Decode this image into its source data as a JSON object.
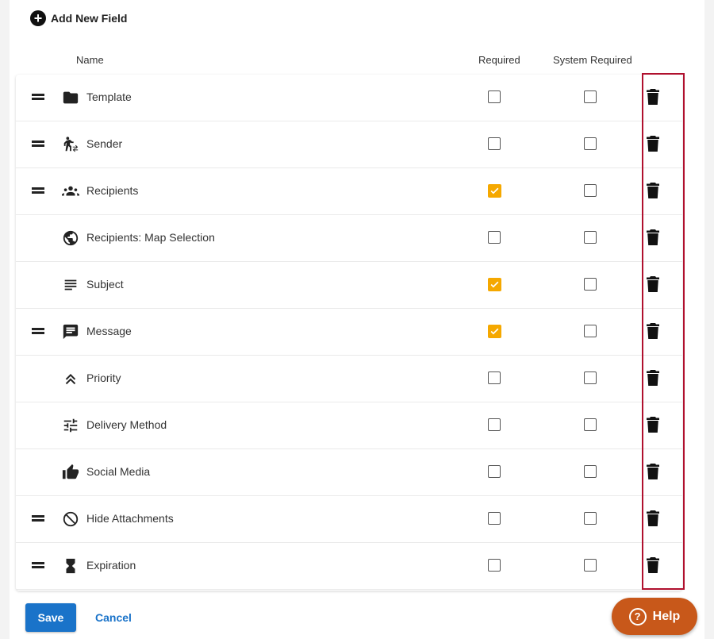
{
  "toolbar": {
    "add_field_label": "Add New Field"
  },
  "columns": {
    "name": "Name",
    "required": "Required",
    "system_required": "System Required"
  },
  "fields": [
    {
      "label": "Template",
      "icon": "folder-icon",
      "draggable": true,
      "required": false,
      "system_required": false
    },
    {
      "label": "Sender",
      "icon": "sender-icon",
      "draggable": true,
      "required": false,
      "system_required": false
    },
    {
      "label": "Recipients",
      "icon": "people-icon",
      "draggable": true,
      "required": true,
      "system_required": false
    },
    {
      "label": "Recipients: Map Selection",
      "icon": "globe-icon",
      "draggable": false,
      "required": false,
      "system_required": false
    },
    {
      "label": "Subject",
      "icon": "subject-lines-icon",
      "draggable": false,
      "required": true,
      "system_required": false
    },
    {
      "label": "Message",
      "icon": "message-icon",
      "draggable": true,
      "required": true,
      "system_required": false
    },
    {
      "label": "Priority",
      "icon": "double-chevron-up-icon",
      "draggable": false,
      "required": false,
      "system_required": false
    },
    {
      "label": "Delivery Method",
      "icon": "tune-icon",
      "draggable": false,
      "required": false,
      "system_required": false
    },
    {
      "label": "Social Media",
      "icon": "thumbs-up-icon",
      "draggable": false,
      "required": false,
      "system_required": false
    },
    {
      "label": "Hide Attachments",
      "icon": "block-icon",
      "draggable": true,
      "required": false,
      "system_required": false
    },
    {
      "label": "Expiration",
      "icon": "hourglass-icon",
      "draggable": true,
      "required": false,
      "system_required": false
    }
  ],
  "footer": {
    "save_label": "Save",
    "cancel_label": "Cancel",
    "help_label": "Help"
  },
  "colors": {
    "accent_checked": "#f5a800",
    "primary": "#1a73c9",
    "help": "#c8581a",
    "highlight": "#b0102e"
  }
}
